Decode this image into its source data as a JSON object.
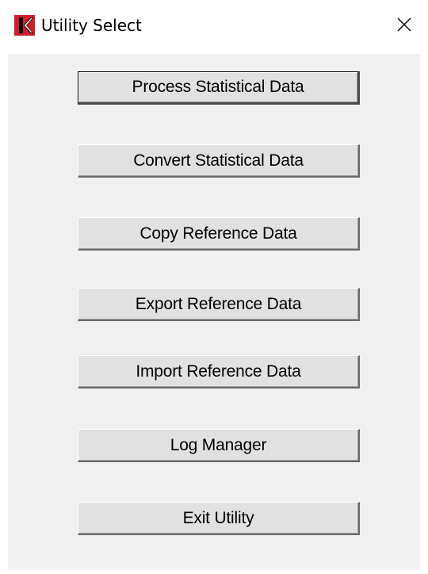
{
  "window": {
    "title": "Utility Select",
    "app_icon": "kodak-k-logo-icon",
    "close_icon": "close-icon",
    "brand_color": "#cc1f2d"
  },
  "buttons": [
    {
      "label": "Process Statistical Data"
    },
    {
      "label": "Convert Statistical Data"
    },
    {
      "label": "Copy Reference Data"
    },
    {
      "label": "Export Reference Data"
    },
    {
      "label": "Import Reference Data"
    },
    {
      "label": "Log Manager"
    },
    {
      "label": "Exit Utility"
    }
  ]
}
